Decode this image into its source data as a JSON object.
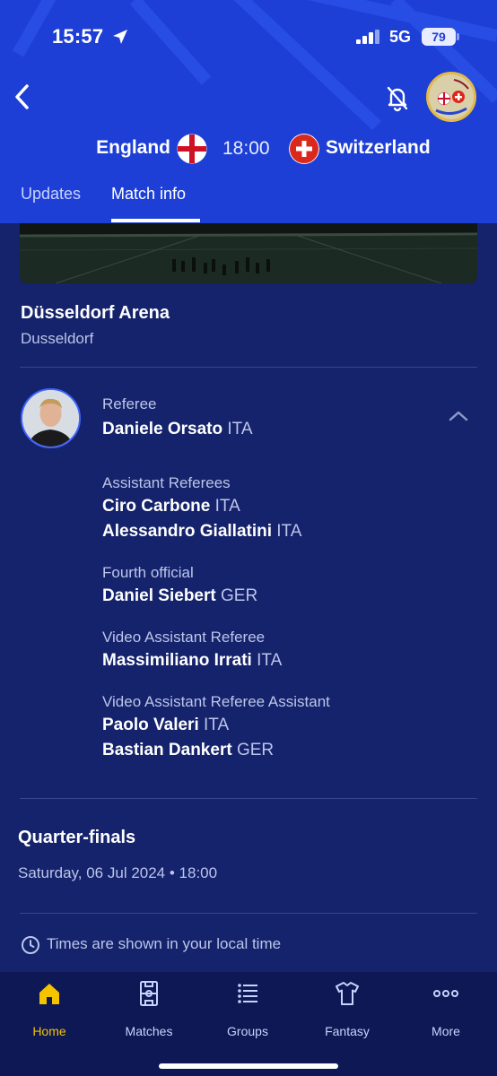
{
  "status_bar": {
    "time": "15:57",
    "network": "5G",
    "battery": "79"
  },
  "header": {
    "home_team": "England",
    "away_team": "Switzerland",
    "kickoff": "18:00",
    "tabs": [
      {
        "label": "Updates",
        "active": false
      },
      {
        "label": "Match info",
        "active": true
      }
    ]
  },
  "venue": {
    "name": "Düsseldorf Arena",
    "city": "Dusseldorf"
  },
  "officials": {
    "referee": {
      "label": "Referee",
      "name": "Daniele Orsato",
      "nat": "ITA"
    },
    "assistants": {
      "label": "Assistant Referees",
      "people": [
        {
          "name": "Ciro Carbone",
          "nat": "ITA"
        },
        {
          "name": "Alessandro Giallatini",
          "nat": "ITA"
        }
      ]
    },
    "fourth": {
      "label": "Fourth official",
      "people": [
        {
          "name": "Daniel Siebert",
          "nat": "GER"
        }
      ]
    },
    "var": {
      "label": "Video Assistant Referee",
      "people": [
        {
          "name": "Massimiliano Irrati",
          "nat": "ITA"
        }
      ]
    },
    "avar": {
      "label": "Video Assistant Referee Assistant",
      "people": [
        {
          "name": "Paolo Valeri",
          "nat": "ITA"
        },
        {
          "name": "Bastian Dankert",
          "nat": "GER"
        }
      ]
    }
  },
  "match": {
    "stage": "Quarter-finals",
    "date": "Saturday, 06 Jul 2024 • 18:00",
    "timezone_note": "Times are shown in your local time"
  },
  "bottom_nav": [
    {
      "label": "Home",
      "icon": "home-icon",
      "active": true
    },
    {
      "label": "Matches",
      "icon": "pitch-icon",
      "active": false
    },
    {
      "label": "Groups",
      "icon": "list-icon",
      "active": false
    },
    {
      "label": "Fantasy",
      "icon": "shirt-icon",
      "active": false
    },
    {
      "label": "More",
      "icon": "more-icon",
      "active": false
    }
  ],
  "colors": {
    "header_blue": "#1d3fd6",
    "background_navy": "#14236b",
    "nav_bg": "#0d1854",
    "active_yellow": "#f5c400"
  }
}
